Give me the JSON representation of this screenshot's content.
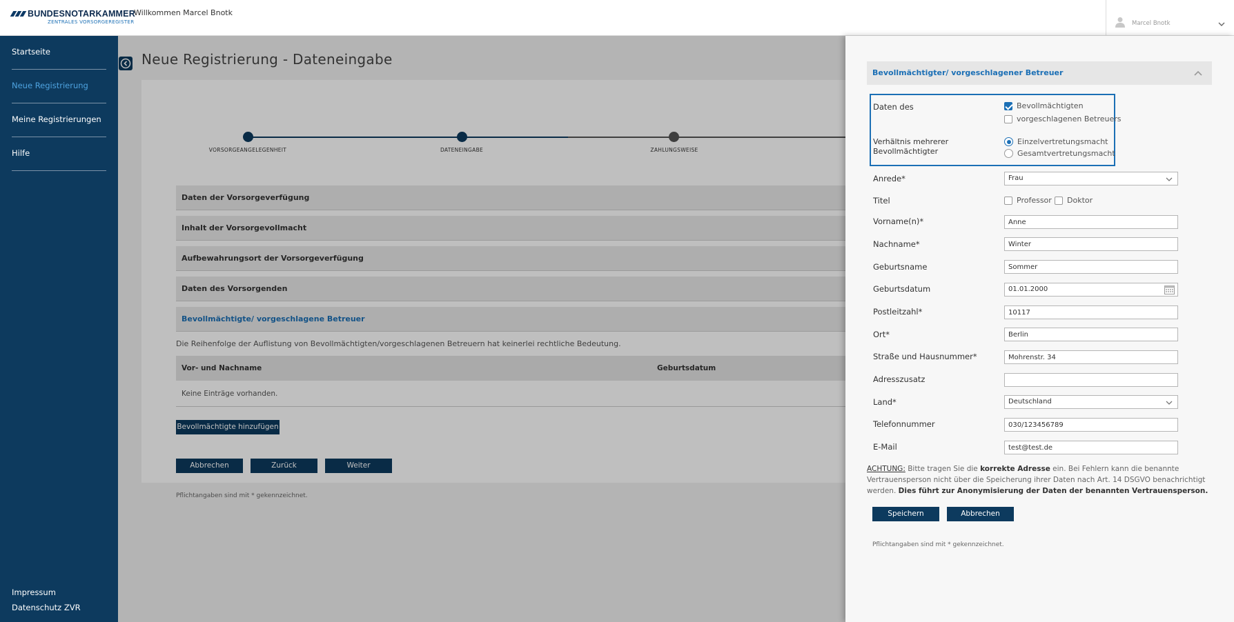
{
  "header": {
    "logo_name": "BUNDESNOTARKAMMER",
    "logo_sub": "ZENTRALES VORSORGEREGISTER",
    "welcome": "Willkommen Marcel Bnotk",
    "user_name": "Marcel Bnotk"
  },
  "sidebar": {
    "items": [
      {
        "label": "Startseite"
      },
      {
        "label": "Neue Registrierung"
      },
      {
        "label": "Meine Registrierungen"
      },
      {
        "label": "Hilfe"
      }
    ],
    "footer": [
      "Impressum",
      "Datenschutz ZVR"
    ]
  },
  "main": {
    "title": "Neue Registrierung - Dateneingabe",
    "steps": [
      "VORSORGEANGELEGENHEIT",
      "DATENEINGABE",
      "ZAHLUNGSWEISE"
    ],
    "sections": [
      "Daten der Vorsorgeverfügung",
      "Inhalt der Vorsorgevollmacht",
      "Aufbewahrungsort der Vorsorgeverfügung",
      "Daten des Vorsorgenden",
      "Bevollmächtigte/ vorgeschlagene Betreuer"
    ],
    "info": "Die Reihenfolge der Auflistung von Bevollmächtigten/vorgeschlagenen Betreuern hat keinerlei rechtliche Bedeutung.",
    "table": {
      "columns": [
        "Vor- und Nachname",
        "Geburtsdatum"
      ],
      "empty": "Keine Einträge vorhanden."
    },
    "add_button": "Bevollmächtigte hinzufügen",
    "buttons": {
      "cancel": "Abbrechen",
      "back": "Zurück",
      "next": "Weiter"
    },
    "required_note": "Pflichtangaben sind mit * gekennzeichnet."
  },
  "drawer": {
    "title": "Bevollmächtigter/ vorgeschlagener Betreuer",
    "daten_des": {
      "label": "Daten des",
      "options": [
        {
          "label": "Bevollmächtigten",
          "checked": true
        },
        {
          "label": "vorgeschlagenen Betreuers",
          "checked": false
        }
      ]
    },
    "verhaeltnis": {
      "label_line1": "Verhältnis mehrerer",
      "label_line2": "Bevollmächtigter",
      "options": [
        {
          "label": "Einzelvertretungsmacht",
          "selected": true
        },
        {
          "label": "Gesamtvertretungsmacht",
          "selected": false
        }
      ]
    },
    "fields": {
      "anrede": {
        "label": "Anrede*",
        "value": "Frau"
      },
      "titel": {
        "label": "Titel",
        "options": [
          "Professor",
          "Doktor"
        ]
      },
      "vorname": {
        "label": "Vorname(n)*",
        "value": "Anne"
      },
      "nachname": {
        "label": "Nachname*",
        "value": "Winter"
      },
      "geburtsname": {
        "label": "Geburtsname",
        "value": "Sommer"
      },
      "geburtsdatum": {
        "label": "Geburtsdatum",
        "value": "01.01.2000"
      },
      "plz": {
        "label": "Postleitzahl*",
        "value": "10117"
      },
      "ort": {
        "label": "Ort*",
        "value": "Berlin"
      },
      "strasse": {
        "label": "Straße und Hausnummer*",
        "value": "Mohrenstr. 34"
      },
      "adresszusatz": {
        "label": "Adresszusatz",
        "value": ""
      },
      "land": {
        "label": "Land*",
        "value": "Deutschland"
      },
      "telefon": {
        "label": "Telefonnummer",
        "value": "030/123456789"
      },
      "email": {
        "label": "E-Mail",
        "value": "test@test.de"
      }
    },
    "warning": {
      "prefix": "ACHTUNG:",
      "part1": " Bitte tragen Sie die ",
      "bold1": "korrekte Adresse",
      "part2": " ein. Bei Fehlern kann die benannte Vertrauensperson nicht über die Speicherung ihrer Daten nach Art. 14 DSGVO benachrichtigt werden. ",
      "bold2": "Dies führt zur Anonymisierung der Daten der benannten Vertrauensperson."
    },
    "save": "Speichern",
    "cancel": "Abbrechen",
    "required_note": "Pflichtangaben sind mit * gekennzeichnet."
  },
  "colors": {
    "navy": "#0d3a5e",
    "accent_blue": "#1b6fb5",
    "step_inactive": "#555555"
  }
}
